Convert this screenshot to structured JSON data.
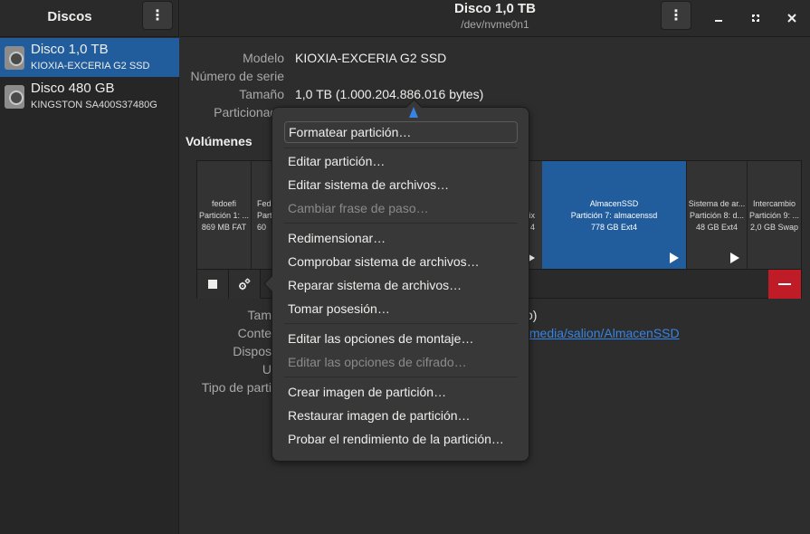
{
  "sidebar": {
    "title": "Discos",
    "disks": [
      {
        "name": "Disco 1,0 TB",
        "model": "KIOXIA-EXCERIA G2 SSD"
      },
      {
        "name": "Disco 480 GB",
        "model": "KINGSTON SA400S37480G"
      }
    ]
  },
  "header": {
    "title": "Disco 1,0 TB",
    "subtitle": "/dev/nvme0n1",
    "menu_icon": "vertical-dots-icon"
  },
  "disk_info": {
    "model_label": "Modelo",
    "model_value": "KIOXIA-EXCERIA G2 SSD",
    "serial_label": "Número de serie",
    "size_label": "Tamaño",
    "size_value": "1,0 TB (1.000.204.886.016 bytes)",
    "partitioning_label": "Particionado"
  },
  "volumes": {
    "title": "Volúmenes",
    "partitions": [
      {
        "name": "fedoefi",
        "line2": "Partición 1: ...",
        "line3": "869 MB FAT"
      },
      {
        "name": "Fed",
        "line2": "Parti",
        "line3": "60"
      },
      {
        "name": "",
        "line2": "rtix",
        "line3": "4"
      },
      {
        "name": "AlmacenSSD",
        "line2": "Partición 7: almacenssd",
        "line3": "778 GB Ext4"
      },
      {
        "name": "Sistema de ar...",
        "line2": "Partición 8: d...",
        "line3": "48 GB Ext4"
      },
      {
        "name": "Intercambio",
        "line2": "Partición 9: ...",
        "line3": "2,0 GB Swap"
      }
    ]
  },
  "partition_details": {
    "size_label": "Tam",
    "size_fragment": "o)",
    "contents_label": "Conte",
    "contents_link": "/media/salion/AlmacenSSD",
    "device_label": "Dispos",
    "uuid_label": "U",
    "uuid_fragment": ":",
    "type_label": "Tipo de parti"
  },
  "menu": {
    "items": [
      {
        "label": "Formatear partición…",
        "enabled": true
      },
      {
        "label": "Editar partición…",
        "enabled": true
      },
      {
        "label": "Editar sistema de archivos…",
        "enabled": true
      },
      {
        "label": "Cambiar frase de paso…",
        "enabled": false
      },
      {
        "label": "Redimensionar…",
        "enabled": true
      },
      {
        "label": "Comprobar sistema de archivos…",
        "enabled": true
      },
      {
        "label": "Reparar sistema de archivos…",
        "enabled": true
      },
      {
        "label": "Tomar posesión…",
        "enabled": true
      },
      {
        "label": "Editar las opciones de montaje…",
        "enabled": true
      },
      {
        "label": "Editar las opciones de cifrado…",
        "enabled": false
      },
      {
        "label": "Crear imagen de partición…",
        "enabled": true
      },
      {
        "label": "Restaurar imagen de partición…",
        "enabled": true
      },
      {
        "label": "Probar el rendimiento de la partición…",
        "enabled": true
      }
    ]
  },
  "colors": {
    "selection": "#215d9c",
    "destructive": "#c01c28",
    "link": "#3584e4"
  }
}
